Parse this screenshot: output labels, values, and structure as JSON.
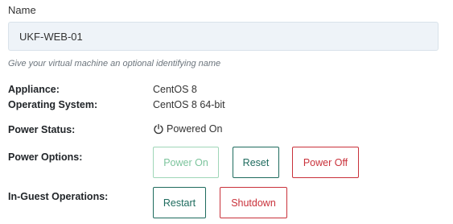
{
  "name_field": {
    "label": "Name",
    "value": "UKF-WEB-01",
    "help": "Give your virtual machine an optional identifying name"
  },
  "details": {
    "appliance_label": "Appliance:",
    "appliance_value": "CentOS 8",
    "os_label": "Operating System:",
    "os_value": "CentOS 8 64-bit",
    "power_status_label": "Power Status:",
    "power_status_value": "Powered On"
  },
  "power_options": {
    "label": "Power Options:",
    "power_on": "Power On",
    "reset": "Reset",
    "power_off": "Power Off"
  },
  "guest_operations": {
    "label": "In-Guest Operations:",
    "restart": "Restart",
    "shutdown": "Shutdown"
  },
  "icons": {
    "power_status": "power-icon"
  },
  "colors": {
    "teal": "#1e6b5e",
    "danger": "#c9313a",
    "success_disabled": "#7cc49c",
    "input_bg": "#eef3f8"
  }
}
